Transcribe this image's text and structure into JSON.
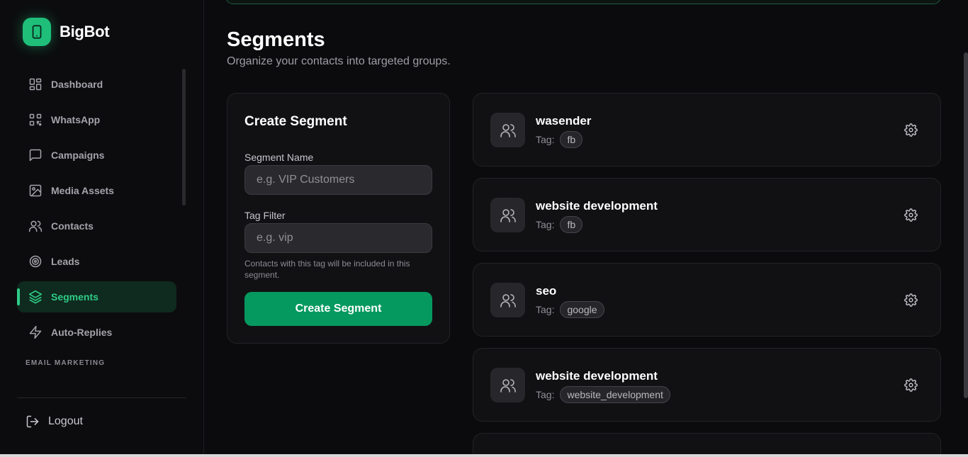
{
  "brand": {
    "name": "BigBot"
  },
  "colors": {
    "accent": "#2ecc86",
    "primary_button": "#05995f",
    "background": "#0b0b0d"
  },
  "sidebar": {
    "items": [
      {
        "label": "Dashboard",
        "icon": "grid-icon",
        "active": false
      },
      {
        "label": "WhatsApp",
        "icon": "qr-code-icon",
        "active": false
      },
      {
        "label": "Campaigns",
        "icon": "message-square-icon",
        "active": false
      },
      {
        "label": "Media Assets",
        "icon": "image-icon",
        "active": false
      },
      {
        "label": "Contacts",
        "icon": "users-icon",
        "active": false
      },
      {
        "label": "Leads",
        "icon": "target-icon",
        "active": false
      },
      {
        "label": "Segments",
        "icon": "layers-icon",
        "active": true
      },
      {
        "label": "Auto-Replies",
        "icon": "zap-icon",
        "active": false
      }
    ],
    "section_label": "EMAIL MARKETING",
    "logout_label": "Logout"
  },
  "page": {
    "title": "Segments",
    "subtitle": "Organize your contacts into targeted groups."
  },
  "create_form": {
    "title": "Create Segment",
    "name_label": "Segment Name",
    "name_placeholder": "e.g. VIP Customers",
    "tag_label": "Tag Filter",
    "tag_placeholder": "e.g. vip",
    "hint": "Contacts with this tag will be included in this segment.",
    "submit_label": "Create Segment"
  },
  "segments": [
    {
      "name": "wasender",
      "tag_label": "Tag:",
      "tag": "fb"
    },
    {
      "name": "website development",
      "tag_label": "Tag:",
      "tag": "fb"
    },
    {
      "name": "seo",
      "tag_label": "Tag:",
      "tag": "google"
    },
    {
      "name": "website development",
      "tag_label": "Tag:",
      "tag": "website_development"
    }
  ]
}
